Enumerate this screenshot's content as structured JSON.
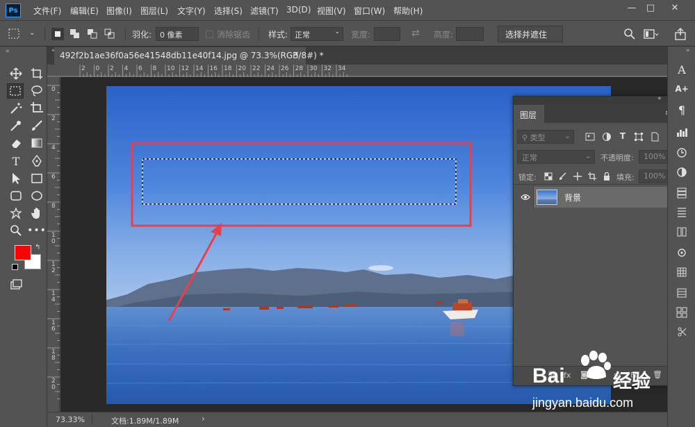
{
  "app": {
    "logo": "Ps",
    "menus": [
      "文件(F)",
      "编辑(E)",
      "图像(I)",
      "图层(L)",
      "文字(Y)",
      "选择(S)",
      "滤镜(T)",
      "3D(D)",
      "视图(V)",
      "窗口(W)",
      "帮助(H)"
    ]
  },
  "options": {
    "feather_label": "羽化:",
    "feather_value": "0 像素",
    "antialias_label": "消除锯齿",
    "style_label": "样式:",
    "style_value": "正常",
    "width_label": "宽度:",
    "height_label": "高度:",
    "select_mask_button": "选择并遮住 ..."
  },
  "document": {
    "tab_title": "492f2b1ae36f0a56e41548db11e40f14.jpg @ 73.3%(RGB/8#) *",
    "zoom": "73.33%",
    "doc_info": "文档:1.89M/1.89M"
  },
  "rulers": {
    "h": [
      "2",
      "0",
      "2",
      "4",
      "6",
      "8",
      "10",
      "12",
      "14",
      "16",
      "18",
      "20",
      "22",
      "24",
      "26",
      "28",
      "30",
      "32",
      "34"
    ],
    "v": [
      "0",
      "2",
      "4",
      "6",
      "8",
      "1\n0",
      "1\n2",
      "1\n4",
      "1\n6",
      "1\n8",
      "2\n0"
    ]
  },
  "layers_panel": {
    "tab_label": "图层",
    "filter_kind": "类型",
    "blend_mode": "正常",
    "opacity_label": "不透明度:",
    "opacity_value": "100%",
    "lock_label": "锁定:",
    "fill_label": "填充:",
    "fill_value": "100%",
    "layer_name": "背景"
  },
  "colors": {
    "foreground": "#ff0000",
    "background": "#ffffff",
    "annotation": "#e8404a",
    "accent": "#31a8ff"
  },
  "watermark": {
    "brand": "Bai",
    "brand2": "经验",
    "url": "jingyan.baidu.com"
  }
}
